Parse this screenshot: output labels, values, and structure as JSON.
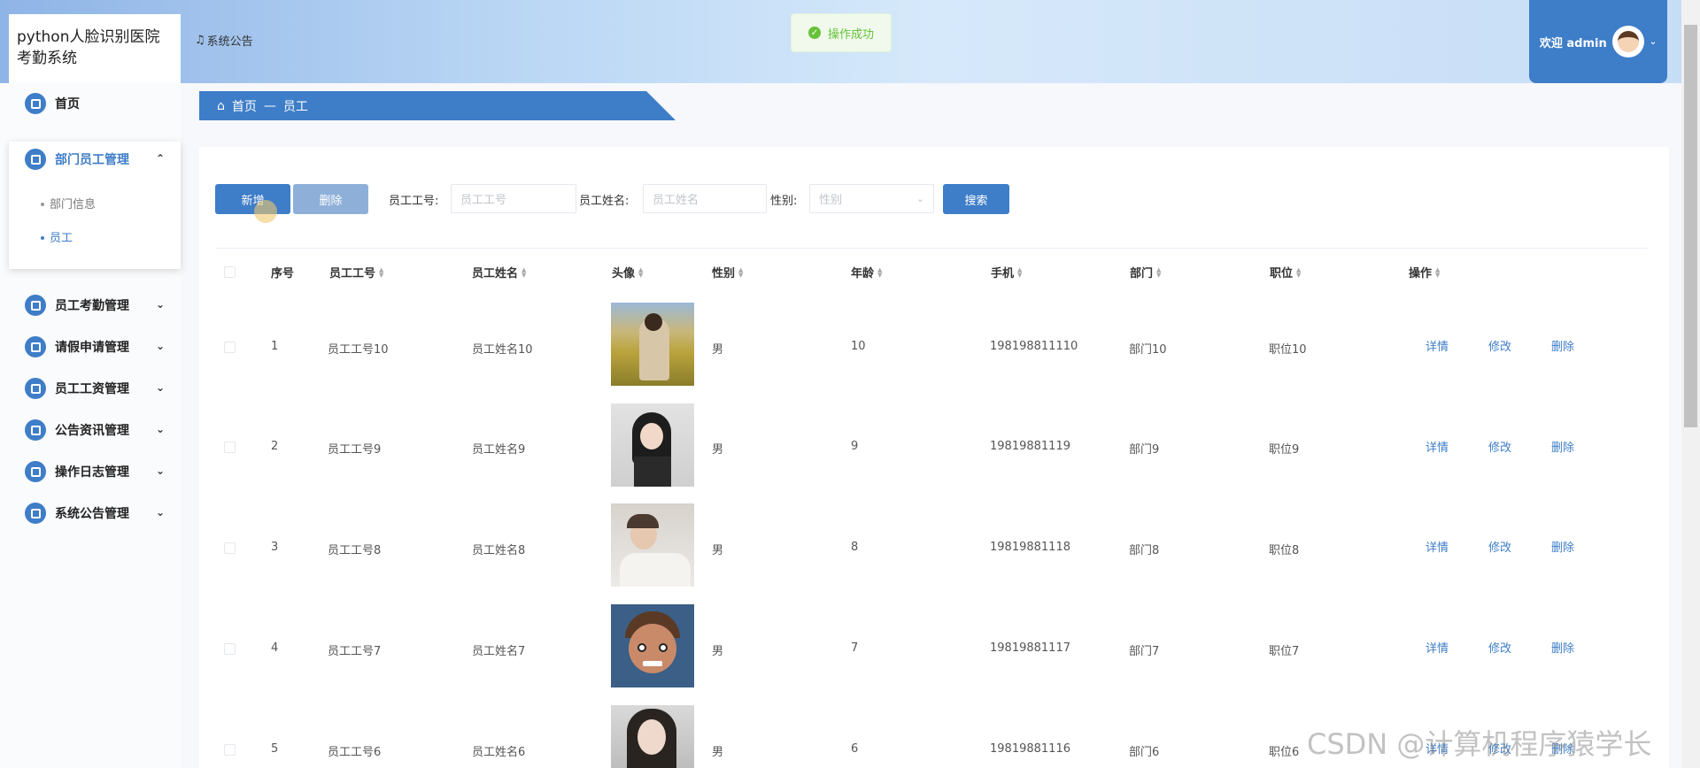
{
  "header": {
    "app_title": "python人脸识别医院考勤系统",
    "notice_link": "系统公告",
    "toast": "操作成功",
    "welcome": "欢迎 admin"
  },
  "sidebar": {
    "items": [
      {
        "label": "首页"
      },
      {
        "label": "部门员工管理"
      },
      {
        "label": "员工考勤管理"
      },
      {
        "label": "请假申请管理"
      },
      {
        "label": "员工工资管理"
      },
      {
        "label": "公告资讯管理"
      },
      {
        "label": "操作日志管理"
      },
      {
        "label": "系统公告管理"
      }
    ],
    "subitems": [
      {
        "label": "部门信息"
      },
      {
        "label": "员工"
      }
    ]
  },
  "breadcrumb": {
    "home": "首页",
    "sep": "—",
    "current": "员工"
  },
  "toolbar": {
    "add": "新增",
    "delete": "删除",
    "search": "搜索",
    "emp_no_label": "员工工号:",
    "emp_no_placeholder": "员工工号",
    "emp_name_label": "员工姓名:",
    "emp_name_placeholder": "员工姓名",
    "gender_label": "性别:",
    "gender_placeholder": "性别"
  },
  "table": {
    "headers": [
      "序号",
      "员工工号",
      "员工姓名",
      "头像",
      "性别",
      "年龄",
      "手机",
      "部门",
      "职位",
      "操作"
    ],
    "actions": [
      "详情",
      "修改",
      "删除"
    ],
    "rows": [
      {
        "idx": "1",
        "no": "员工工号10",
        "name": "员工姓名10",
        "gender": "男",
        "age": "10",
        "phone": "198198811110",
        "dept": "部门10",
        "pos": "职位10"
      },
      {
        "idx": "2",
        "no": "员工工号9",
        "name": "员工姓名9",
        "gender": "男",
        "age": "9",
        "phone": "19819881119",
        "dept": "部门9",
        "pos": "职位9"
      },
      {
        "idx": "3",
        "no": "员工工号8",
        "name": "员工姓名8",
        "gender": "男",
        "age": "8",
        "phone": "19819881118",
        "dept": "部门8",
        "pos": "职位8"
      },
      {
        "idx": "4",
        "no": "员工工号7",
        "name": "员工姓名7",
        "gender": "男",
        "age": "7",
        "phone": "19819881117",
        "dept": "部门7",
        "pos": "职位7"
      },
      {
        "idx": "5",
        "no": "员工工号6",
        "name": "员工姓名6",
        "gender": "男",
        "age": "6",
        "phone": "19819881116",
        "dept": "部门6",
        "pos": "职位6"
      }
    ]
  },
  "watermark": "CSDN @计算机程序猿学长"
}
